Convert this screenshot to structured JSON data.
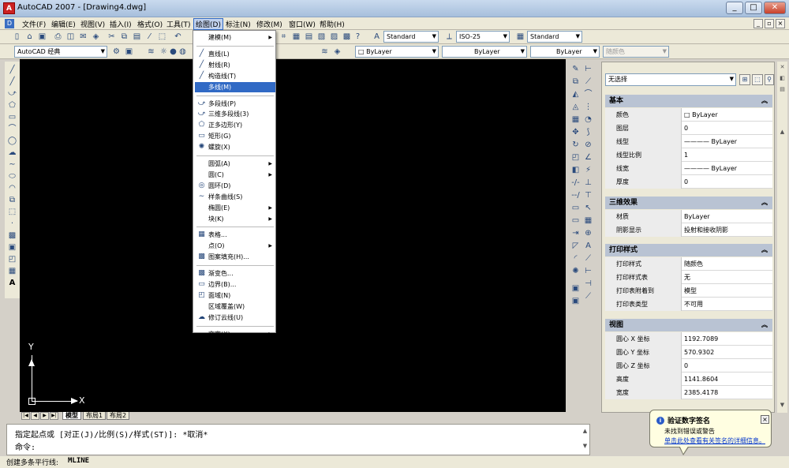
{
  "window": {
    "title": "AutoCAD 2007 - [Drawing4.dwg]",
    "min": "_",
    "max": "□",
    "close": "✕"
  },
  "menubar": [
    "文件(F)",
    "编辑(E)",
    "视图(V)",
    "插入(I)",
    "格式(O)",
    "工具(T)",
    "绘图(D)",
    "标注(N)",
    "修改(M)",
    "窗口(W)",
    "帮助(H)"
  ],
  "toolbar": {
    "workspace": "AutoCAD 经典",
    "text_style": "Standard",
    "dim_style": "ISO-25",
    "table_style": "Standard",
    "color": "ByLayer",
    "linetype": "ByLayer",
    "lineweight": "ByLayer",
    "plotstyle": "随颜色"
  },
  "draw_menu": [
    {
      "label": "建模(M)",
      "icon": "",
      "submenu": true
    },
    {
      "sep": true
    },
    {
      "label": "直线(L)",
      "icon": "╱"
    },
    {
      "label": "射线(R)",
      "icon": "╱"
    },
    {
      "label": "构造线(T)",
      "icon": "╱"
    },
    {
      "label": "多线(M)",
      "icon": "",
      "highlight": true
    },
    {
      "sep": true
    },
    {
      "label": "多段线(P)",
      "icon": "⤻"
    },
    {
      "label": "三维多段线(3)",
      "icon": "⤻"
    },
    {
      "label": "正多边形(Y)",
      "icon": "⬠"
    },
    {
      "label": "矩形(G)",
      "icon": "▭"
    },
    {
      "label": "螺旋(X)",
      "icon": "✺"
    },
    {
      "sep": true
    },
    {
      "label": "圆弧(A)",
      "icon": "",
      "submenu": true
    },
    {
      "label": "圆(C)",
      "icon": "",
      "submenu": true
    },
    {
      "label": "圆环(D)",
      "icon": "◎"
    },
    {
      "label": "样条曲线(S)",
      "icon": "∼"
    },
    {
      "label": "椭圆(E)",
      "icon": "",
      "submenu": true
    },
    {
      "label": "块(K)",
      "icon": "",
      "submenu": true
    },
    {
      "sep": true
    },
    {
      "label": "表格...",
      "icon": "▦"
    },
    {
      "label": "点(O)",
      "icon": "",
      "submenu": true
    },
    {
      "label": "图案填充(H)...",
      "icon": "▩"
    },
    {
      "sep": true
    },
    {
      "label": "渐变色...",
      "icon": "▩"
    },
    {
      "label": "边界(B)...",
      "icon": "▭"
    },
    {
      "label": "面域(N)",
      "icon": "◰"
    },
    {
      "label": "区域覆盖(W)",
      "icon": ""
    },
    {
      "label": "修订云线(U)",
      "icon": "☁"
    },
    {
      "sep": true
    },
    {
      "label": "文字(X)",
      "icon": "",
      "submenu": true
    }
  ],
  "ucs": {
    "y": "Y",
    "x": "X"
  },
  "layout_tabs": [
    "模型",
    "布局1",
    "布局2"
  ],
  "properties": {
    "selection": "无选择",
    "sections": [
      {
        "title": "基本",
        "rows": [
          {
            "name": "颜色",
            "value": "□ ByLayer"
          },
          {
            "name": "图层",
            "value": "0"
          },
          {
            "name": "线型",
            "value": "———— ByLayer"
          },
          {
            "name": "线型比例",
            "value": "1"
          },
          {
            "name": "线宽",
            "value": "———— ByLayer"
          },
          {
            "name": "厚度",
            "value": "0"
          }
        ]
      },
      {
        "title": "三维效果",
        "rows": [
          {
            "name": "材质",
            "value": "ByLayer"
          },
          {
            "name": "阴影显示",
            "value": "投射和接收阴影"
          }
        ]
      },
      {
        "title": "打印样式",
        "rows": [
          {
            "name": "打印样式",
            "value": "随颜色"
          },
          {
            "name": "打印样式表",
            "value": "无"
          },
          {
            "name": "打印表附着到",
            "value": "模型"
          },
          {
            "name": "打印表类型",
            "value": "不可用"
          }
        ]
      },
      {
        "title": "视图",
        "rows": [
          {
            "name": "圆心 X 坐标",
            "value": "1192.7089"
          },
          {
            "name": "圆心 Y 坐标",
            "value": "570.9302"
          },
          {
            "name": "圆心 Z 坐标",
            "value": "0"
          },
          {
            "name": "高度",
            "value": "1141.8604"
          },
          {
            "name": "宽度",
            "value": "2385.4178"
          }
        ]
      }
    ]
  },
  "command": {
    "line1": "指定起点或 [对正(J)/比例(S)/样式(ST)]:  *取消*",
    "line2": "命令:"
  },
  "status": {
    "text": "创建多条平行线:",
    "cmd": "MLINE"
  },
  "balloon": {
    "title": "验证数字签名",
    "message": "未找到错误或警告",
    "link": "单击此处查看有关签名的详细信息。"
  }
}
